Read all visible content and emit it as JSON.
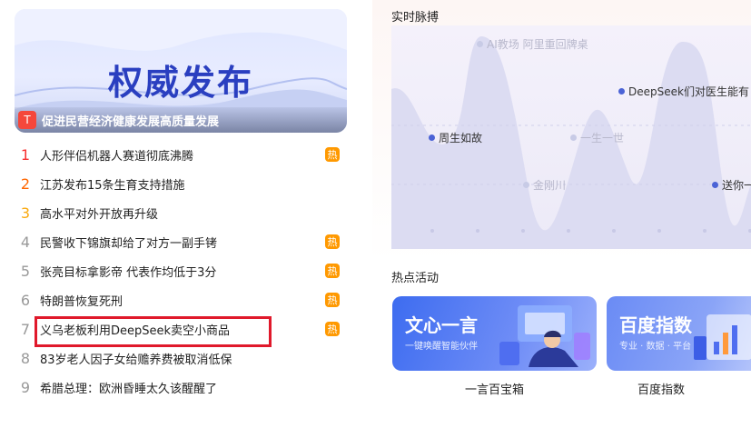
{
  "banner": {
    "title": "权威发布",
    "badge": "T",
    "caption": "促进民营经济健康发展高质量发展"
  },
  "hot_list": {
    "tag_label": "热",
    "items": [
      {
        "rank": "1",
        "title": "人形伴侣机器人赛道彻底沸腾",
        "hot": true
      },
      {
        "rank": "2",
        "title": "江苏发布15条生育支持措施",
        "hot": false
      },
      {
        "rank": "3",
        "title": "高水平对外开放再升级",
        "hot": false
      },
      {
        "rank": "4",
        "title": "民警收下锦旗却给了对方一副手铐",
        "hot": true
      },
      {
        "rank": "5",
        "title": "张亮目标拿影帝 代表作均低于3分",
        "hot": true
      },
      {
        "rank": "6",
        "title": "特朗普恢复死刑",
        "hot": true
      },
      {
        "rank": "7",
        "title": "义乌老板利用DeepSeek卖空小商品",
        "hot": true
      },
      {
        "rank": "8",
        "title": "83岁老人因子女给赡养费被取消低保",
        "hot": false
      },
      {
        "rank": "9",
        "title": "希腊总理：欧洲昏睡太久该醒醒了",
        "hot": false
      }
    ]
  },
  "pulse": {
    "section_title": "实时脉搏",
    "labels": [
      {
        "text": "AI教场 阿里重回牌桌",
        "faded": true
      },
      {
        "text": "DeepSeek们对医生能有",
        "faded": false
      },
      {
        "text": "周生如故",
        "faded": false
      },
      {
        "text": "一生一世",
        "faded": true
      },
      {
        "text": "金刚川",
        "faded": true
      },
      {
        "text": "送你一",
        "faded": false
      }
    ]
  },
  "activities": {
    "section_title": "热点活动",
    "cards": [
      {
        "name": "文心一言",
        "subtitle": "一键唤醒智能伙伴",
        "label": "一言百宝箱"
      },
      {
        "name": "百度指数",
        "subtitle": "专业 · 数据 · 平台",
        "label": "百度指数"
      }
    ]
  }
}
